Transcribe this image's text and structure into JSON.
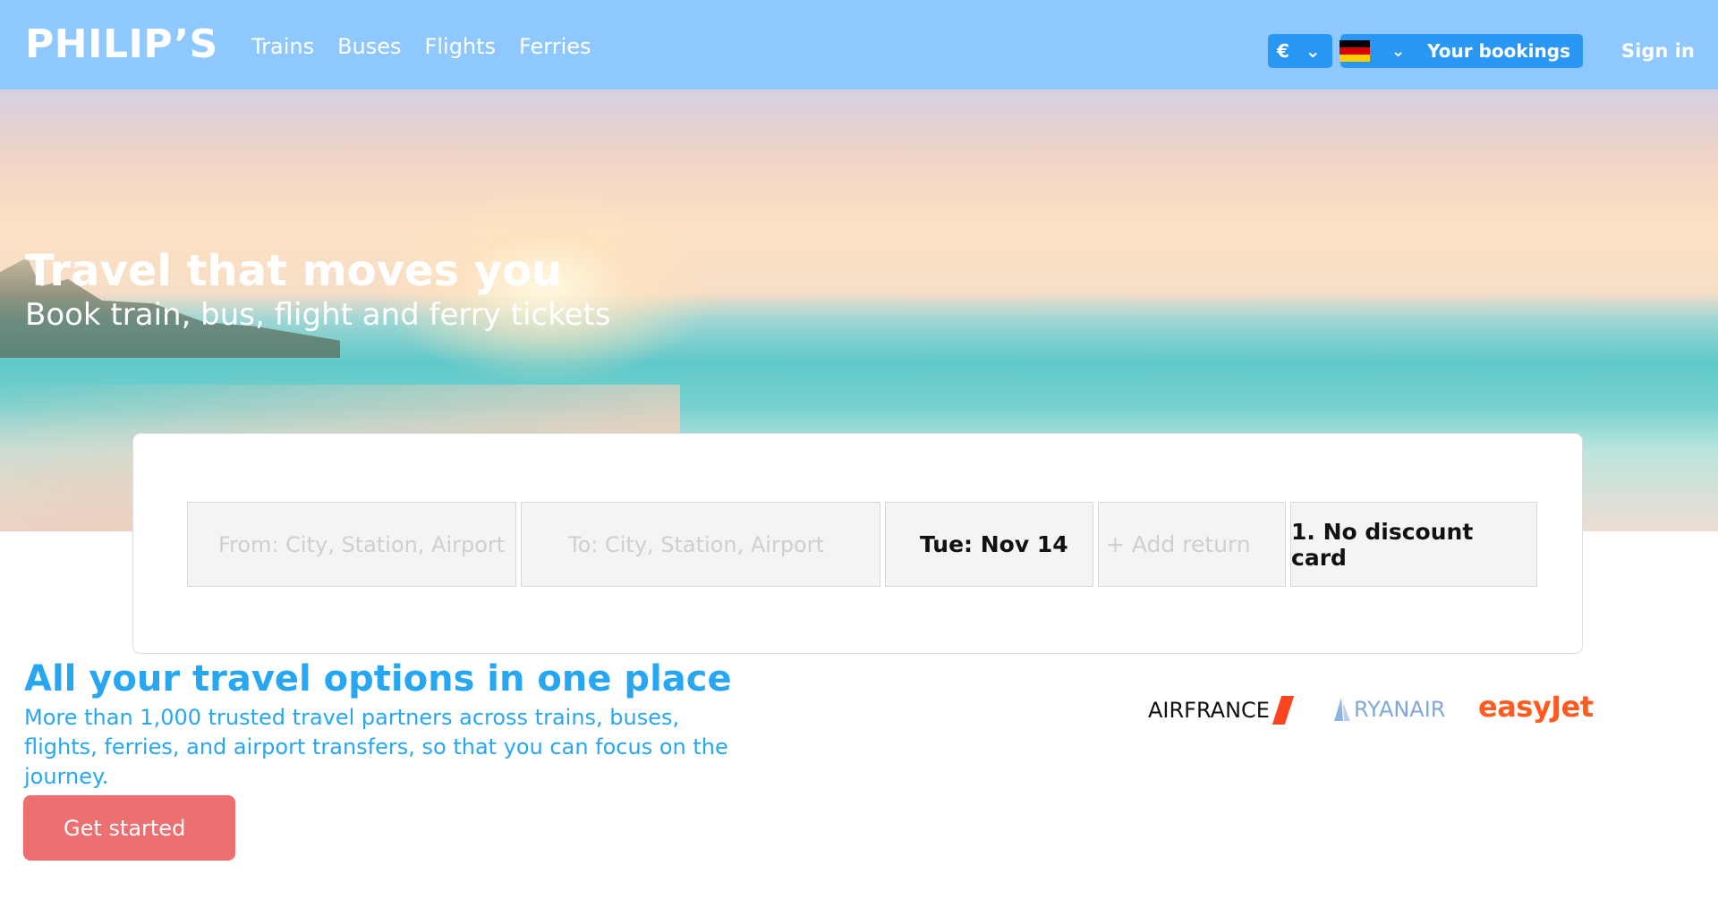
{
  "header": {
    "logo": "PHILIP’S",
    "nav": [
      "Trains",
      "Buses",
      "Flights",
      "Ferries"
    ],
    "currency": "€",
    "currency_chevron": "⌄",
    "language_chevron": "⌄",
    "bookings_label": "Your bookings",
    "signin_label": "Sign in"
  },
  "hero": {
    "title": "Travel that moves you",
    "subtitle": "Book train, bus, flight and ferry tickets"
  },
  "search": {
    "from_placeholder": "From: City, Station, Airport",
    "to_placeholder": "To: City, Station, Airport",
    "date": "Tue: Nov 14",
    "return_label": "+ Add return",
    "discount": "1. No discount card"
  },
  "section": {
    "title": "All your travel options in one place",
    "text": "More than 1,000 trusted travel partners across trains, buses, flights, ferries, and airport transfers, so that you can focus on the journey.",
    "cta": "Get started"
  },
  "partners": {
    "airfrance": "AIRFRANCE",
    "ryanair": "RYANAIR",
    "easyjet": "easyJet"
  },
  "colors": {
    "header_bg": "#8fc8ff",
    "pill_blue": "#2b97f5",
    "accent_text": "#27a6f2",
    "cta_bg": "#ed6f70"
  }
}
